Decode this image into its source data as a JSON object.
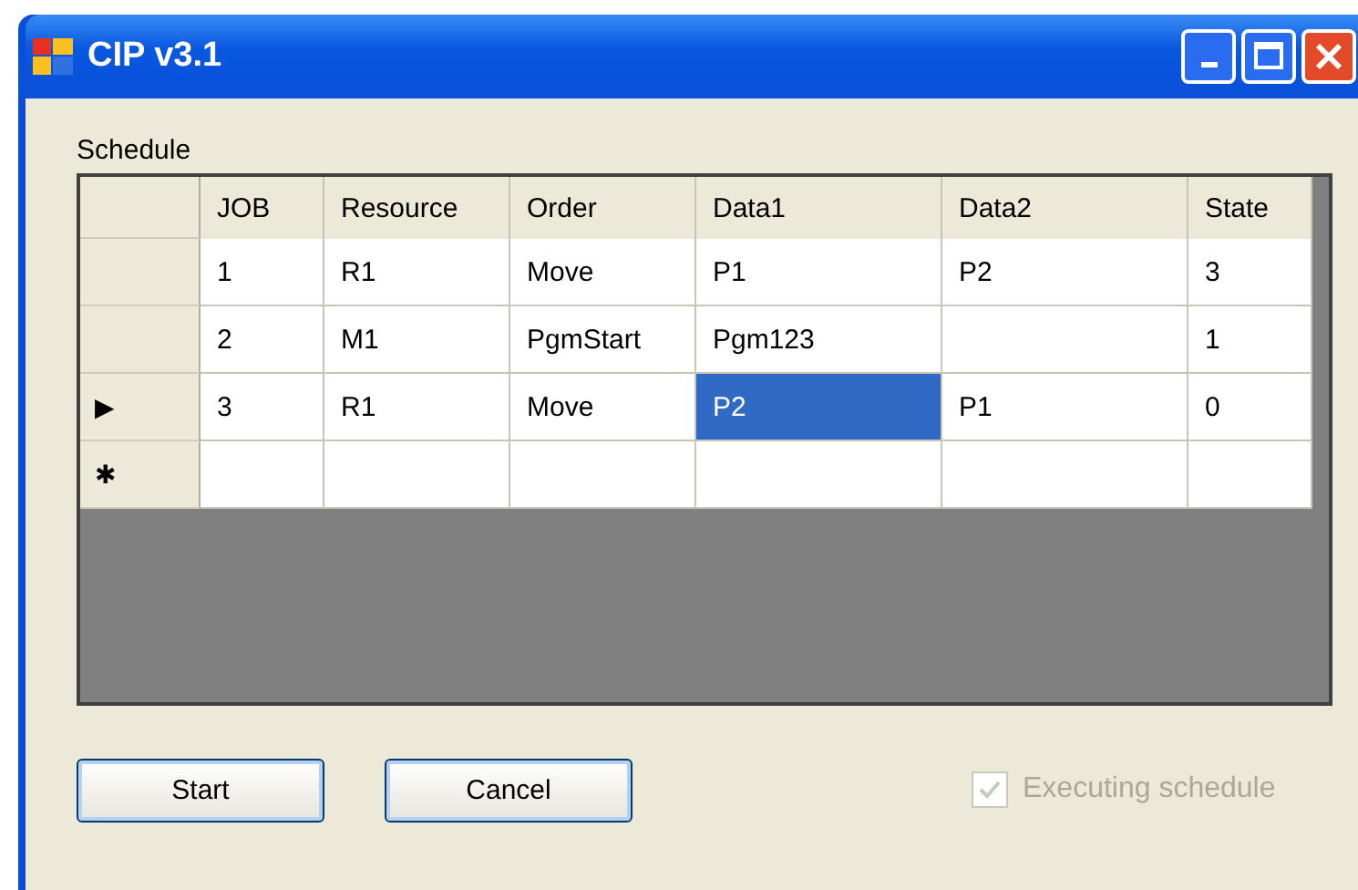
{
  "window": {
    "title": "CIP v3.1"
  },
  "schedule": {
    "label": "Schedule",
    "columns": [
      "JOB",
      "Resource",
      "Order",
      "Data1",
      "Data2",
      "State"
    ],
    "rows": [
      {
        "marker": null,
        "cells": [
          {
            "text": "1",
            "selected": false
          },
          {
            "text": "R1",
            "selected": false
          },
          {
            "text": "Move",
            "selected": false
          },
          {
            "text": "P1",
            "selected": false
          },
          {
            "text": "P2",
            "selected": false
          },
          {
            "text": "3",
            "selected": false
          }
        ]
      },
      {
        "marker": null,
        "cells": [
          {
            "text": "2",
            "selected": false
          },
          {
            "text": "M1",
            "selected": false
          },
          {
            "text": "PgmStart",
            "selected": false
          },
          {
            "text": "Pgm123",
            "selected": false
          },
          {
            "selected": false
          },
          {
            "text": "1",
            "selected": false
          }
        ]
      },
      {
        "marker": "▶",
        "cells": [
          {
            "text": "3",
            "selected": false
          },
          {
            "text": "R1",
            "selected": false
          },
          {
            "text": "Move",
            "selected": false
          },
          {
            "text": "P2",
            "selected": true
          },
          {
            "text": "P1",
            "selected": false
          },
          {
            "text": "0",
            "selected": false
          }
        ]
      },
      {
        "marker": "✱",
        "cells": [
          {
            "selected": false
          },
          {
            "selected": false
          },
          {
            "selected": false
          },
          {
            "selected": false
          },
          {
            "selected": false
          },
          {
            "selected": false
          }
        ]
      }
    ]
  },
  "buttons": [
    "Start",
    "Cancel"
  ],
  "checkbox": {
    "label": "Executing schedule",
    "checked": true,
    "disabled": true
  }
}
